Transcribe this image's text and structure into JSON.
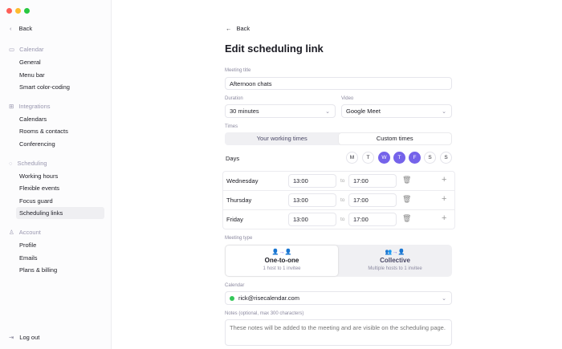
{
  "window": {
    "controls": [
      "#fe5f57",
      "#febc2e",
      "#28c840"
    ]
  },
  "sidebar": {
    "back": "Back",
    "sections": [
      {
        "label": "Calendar",
        "icon": "calendar-icon",
        "items": [
          "General",
          "Menu bar",
          "Smart color-coding"
        ]
      },
      {
        "label": "Integrations",
        "icon": "integrations-icon",
        "items": [
          "Calendars",
          "Rooms & contacts",
          "Conferencing"
        ]
      },
      {
        "label": "Scheduling",
        "icon": "scheduling-icon",
        "items": [
          "Working hours",
          "Flexible events",
          "Focus guard",
          "Scheduling links"
        ]
      },
      {
        "label": "Account",
        "icon": "user-icon",
        "items": [
          "Profile",
          "Emails",
          "Plans & billing"
        ]
      }
    ],
    "active": "Scheduling links",
    "logout": "Log out"
  },
  "main": {
    "back": "Back",
    "title": "Edit scheduling link",
    "meeting_title": {
      "label": "Meeting title",
      "value": "Afternoon chats"
    },
    "duration": {
      "label": "Duration",
      "value": "30 minutes"
    },
    "video": {
      "label": "Video",
      "value": "Google Meet"
    },
    "times": {
      "label": "Times",
      "options": [
        "Your working times",
        "Custom times"
      ],
      "selected": "Custom times"
    },
    "days": {
      "label": "Days",
      "items": [
        {
          "l": "M",
          "on": false
        },
        {
          "l": "T",
          "on": false
        },
        {
          "l": "W",
          "on": true
        },
        {
          "l": "T",
          "on": true
        },
        {
          "l": "F",
          "on": true
        },
        {
          "l": "S",
          "on": false
        },
        {
          "l": "S",
          "on": false
        }
      ]
    },
    "to": "to",
    "rows": [
      {
        "day": "Wednesday",
        "from": "13:00",
        "to": "17:00"
      },
      {
        "day": "Thursday",
        "from": "13:00",
        "to": "17:00"
      },
      {
        "day": "Friday",
        "from": "13:00",
        "to": "17:00"
      }
    ],
    "meeting_type": {
      "label": "Meeting type",
      "options": [
        {
          "title": "One-to-one",
          "sub": "1 host to 1 invitee"
        },
        {
          "title": "Collective",
          "sub": "Multiple hosts to 1 invitee"
        }
      ],
      "selected": "One-to-one"
    },
    "calendar": {
      "label": "Calendar",
      "value": "rick@risecalendar.com",
      "color": "#34c759"
    },
    "notes": {
      "label": "Notes (optional, max 300 characters)",
      "placeholder": "These notes will be added to the meeting and are visible on the scheduling page."
    },
    "accent": "#7563ea"
  }
}
